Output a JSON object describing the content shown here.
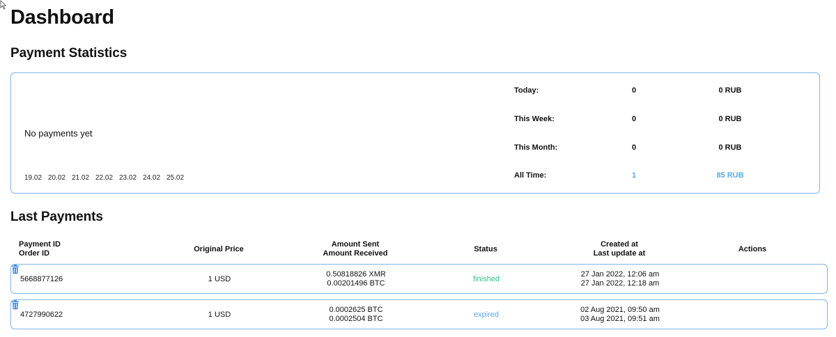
{
  "page_title": "Dashboard",
  "stats": {
    "title": "Payment Statistics",
    "empty_text": "No payments yet",
    "dates": [
      "19.02",
      "20.02",
      "21.02",
      "22.02",
      "23.02",
      "24.02",
      "25.02"
    ],
    "rows": [
      {
        "label": "Today:",
        "count": "0",
        "amount": "0 RUB"
      },
      {
        "label": "This Week:",
        "count": "0",
        "amount": "0 RUB"
      },
      {
        "label": "This Month:",
        "count": "0",
        "amount": "0 RUB"
      },
      {
        "label": "All Time:",
        "count": "1",
        "amount": "85 RUB"
      }
    ]
  },
  "payments": {
    "title": "Last Payments",
    "headers": {
      "id_line1": "Payment ID",
      "id_line2": "Order ID",
      "price": "Original Price",
      "amount_line1": "Amount Sent",
      "amount_line2": "Amount Received",
      "status": "Status",
      "created_line1": "Created at",
      "created_line2": "Last update at",
      "actions": "Actions"
    },
    "rows": [
      {
        "payment_id": "5668877126",
        "price": "1 USD",
        "amount_sent": "0.50818826 XMR",
        "amount_received": "0.00201496 BTC",
        "status": "finished",
        "created_at": "27 Jan 2022, 12:06 am",
        "updated_at": "27 Jan 2022, 12:18 am"
      },
      {
        "payment_id": "4727990622",
        "price": "1 USD",
        "amount_sent": "0.0002625 BTC",
        "amount_received": "0.0002504 BTC",
        "status": "expired",
        "created_at": "02 Aug 2021, 09:50 am",
        "updated_at": "03 Aug 2021, 09:51 am"
      }
    ]
  },
  "colors": {
    "accent": "#5aa8e8",
    "border": "#7fb5e8",
    "finished": "#2fc08a",
    "expired": "#5aa8e8"
  },
  "icons": {
    "cursor": "mouse-pointer-icon",
    "delete": "trash-icon"
  }
}
